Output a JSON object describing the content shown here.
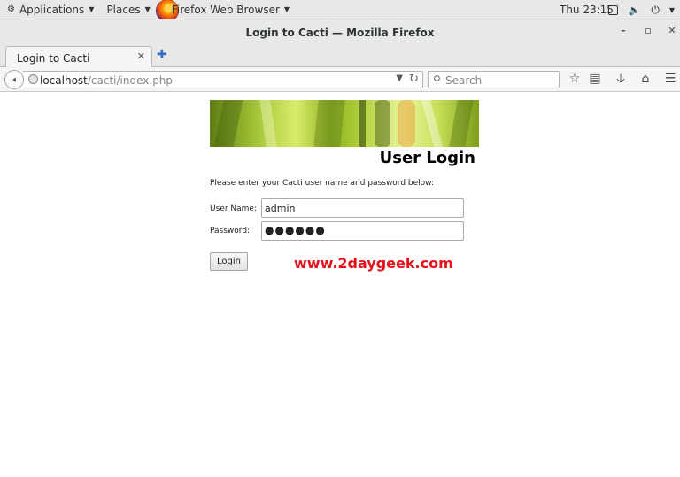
{
  "topbar": {
    "applications": "Applications",
    "places": "Places",
    "app_name": "Firefox Web Browser",
    "clock": "Thu 23:15"
  },
  "window": {
    "title": "Login to Cacti — Mozilla Firefox"
  },
  "tab": {
    "label": "Login to Cacti"
  },
  "navbar": {
    "url_host": "localhost",
    "url_path": "/cacti/index.php",
    "search_placeholder": "Search"
  },
  "page": {
    "heading": "User Login",
    "instructions": "Please enter your Cacti user name and password below:",
    "username_label": "User Name:",
    "username_value": "admin",
    "password_label": "Password:",
    "password_value": "●●●●●●",
    "login_button": "Login",
    "watermark": "www.2daygeek.com"
  },
  "colors": {
    "watermark": "#e8101a",
    "banner_green": "#a7c83a"
  }
}
